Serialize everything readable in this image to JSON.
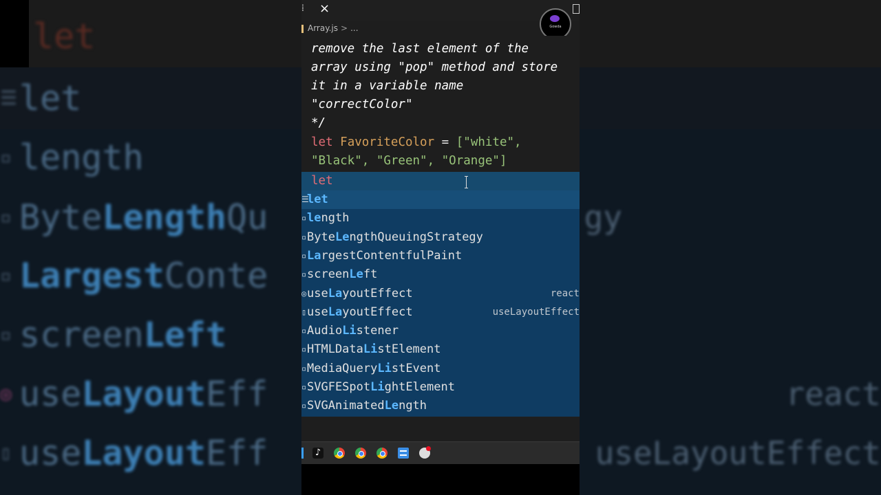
{
  "editor": {
    "tab": {
      "close_glyph": "×"
    },
    "breadcrumb": {
      "file": "Array.js",
      "separator": ">",
      "more": "..."
    },
    "code_lines": [
      "remove the last element of the",
      "array using \"pop\" method and store",
      "it in a variable name",
      "\"correctColor\"",
      "*/"
    ],
    "declaration": {
      "keyword": "let",
      "name": "FavoriteColor",
      "op": "=",
      "line1_values": "[\"white\",",
      "line2_values": "\"Black\", \"Green\", \"Orange\"]"
    },
    "current_line": {
      "text": "let"
    }
  },
  "suggestions": [
    {
      "pre": "",
      "hl": "let",
      "post": "",
      "detail": "",
      "icon": "keyword-icon",
      "selected": true
    },
    {
      "pre": "",
      "hl": "le",
      "post": "ngth",
      "detail": "",
      "icon": "property-icon"
    },
    {
      "pre": "Byte",
      "hl": "Le",
      "post": "ngthQueuingStrategy",
      "detail": "",
      "icon": "class-icon"
    },
    {
      "pre": "",
      "hl": "La",
      "post": "rgestContentfulPaint",
      "detail": "",
      "icon": "class-icon"
    },
    {
      "pre": "screen",
      "hl": "Le",
      "post": "ft",
      "detail": "",
      "icon": "property-icon"
    },
    {
      "pre": "use",
      "hl": "La",
      "post": "youtEffect",
      "detail": "react",
      "icon": "function-icon"
    },
    {
      "pre": "use",
      "hl": "La",
      "post": "youtEffect",
      "detail": "useLayoutEffect",
      "icon": "snippet-icon"
    },
    {
      "pre": "Audio",
      "hl": "Li",
      "post": "stener",
      "detail": "",
      "icon": "class-icon"
    },
    {
      "pre": "HTMLData",
      "hl": "Li",
      "post": "stElement",
      "detail": "",
      "icon": "class-icon"
    },
    {
      "pre": "MediaQuery",
      "hl": "Li",
      "post": "stEvent",
      "detail": "",
      "icon": "class-icon"
    },
    {
      "pre": "SVGFESpot",
      "hl": "Li",
      "post": "ghtElement",
      "detail": "",
      "icon": "class-icon"
    },
    {
      "pre": "SVGAnimated",
      "hl": "Le",
      "post": "ngth",
      "detail": "",
      "icon": "class-icon"
    }
  ],
  "channel_logo": {
    "text": "Gowda"
  },
  "taskbar": {
    "icons": [
      "tiktok-icon",
      "chrome-icon",
      "chrome-icon",
      "chrome-icon",
      "notepad-icon",
      "alert-icon"
    ],
    "tiktok_glyph": "♪"
  },
  "background_zoom": {
    "top_word": "let",
    "rows": [
      {
        "pre": "",
        "hl": "",
        "post": "let",
        "right": ""
      },
      {
        "pre": "",
        "hl": "",
        "post": "length",
        "right": ""
      },
      {
        "pre": "Byte",
        "hl": "Length",
        "post": "Qu",
        "right": "gy"
      },
      {
        "pre": "",
        "hl": "Largest",
        "post": "Conte",
        "right": ""
      },
      {
        "pre": "screen",
        "hl": "Left",
        "post": "",
        "right": ""
      },
      {
        "pre": "use",
        "hl": "Layout",
        "post": "Eff",
        "right": "react"
      },
      {
        "pre": "use",
        "hl": "Layout",
        "post": "Eff",
        "right": "useLayoutEffect"
      }
    ],
    "colors": {
      "highlight": "#3d7fb4",
      "text": "#4b6a86"
    }
  },
  "colors": {
    "editor_bg": "#1e1e1e",
    "suggest_bg": "#0f3c62",
    "selected_bg": "#174e78",
    "match_highlight": "#5cb8ff",
    "keyword": "#e06c75",
    "string": "#98c379",
    "identifier": "#d6a05a"
  }
}
